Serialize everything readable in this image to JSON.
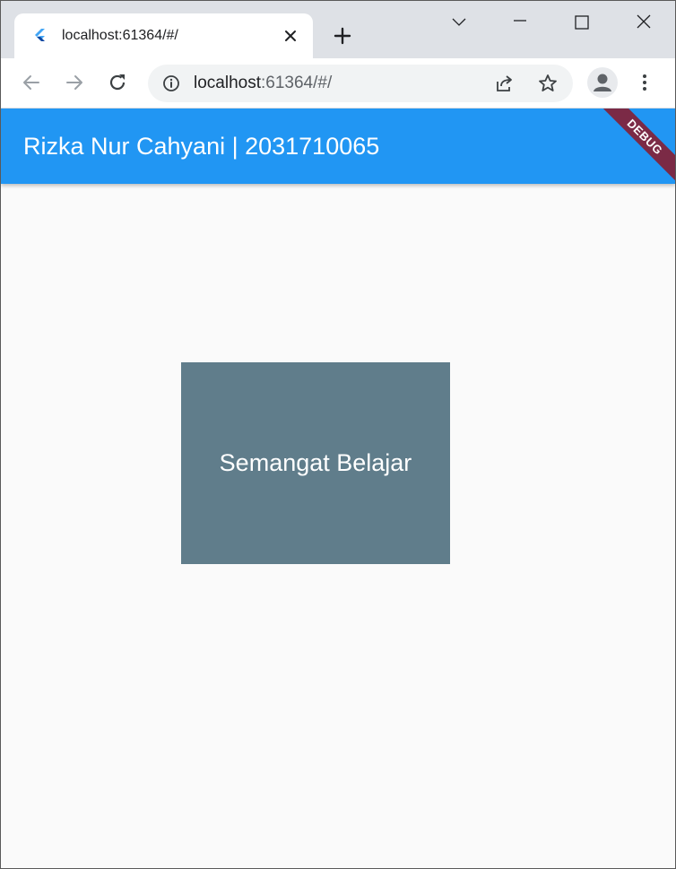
{
  "browser": {
    "tab": {
      "title": "localhost:61364/#/",
      "favicon": "flutter-logo-icon"
    },
    "address_bar": {
      "host": "localhost",
      "path": ":61364/#/"
    },
    "icons": {
      "back": "arrow-left-icon",
      "forward": "arrow-right-icon",
      "reload": "reload-icon",
      "info": "info-icon",
      "share": "share-icon",
      "bookmark": "star-icon",
      "profile": "avatar-icon",
      "menu": "kebab-menu-icon",
      "new_tab": "plus-icon",
      "close_tab": "close-icon",
      "window_menu": "chevron-down-icon",
      "minimize": "minimize-icon",
      "maximize": "maximize-icon",
      "close_window": "close-icon"
    }
  },
  "app": {
    "appbar_title": "Rizka Nur Cahyani | 2031710065",
    "debug_banner": "DEBUG",
    "card_text": "Semangat Belajar",
    "colors": {
      "appbar": "#2196f3",
      "card": "#607d8b",
      "debug_banner": "#7b2a46",
      "background": "#fafafa"
    }
  }
}
